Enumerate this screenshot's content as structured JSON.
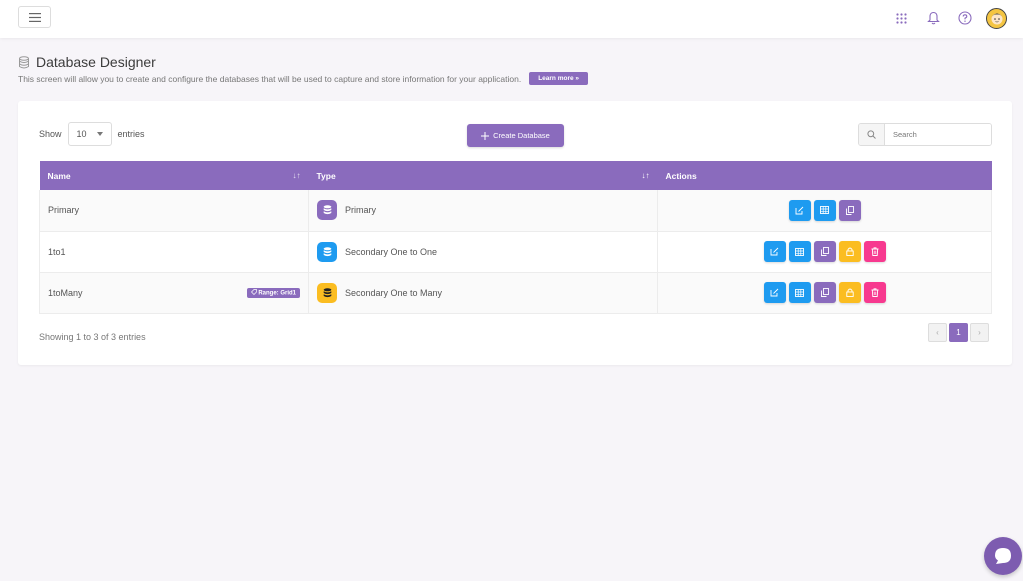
{
  "page": {
    "title": "Database Designer",
    "description": "This screen will allow you to create and configure the databases that will be used to capture and store information for your application.",
    "learn_more": "Learn more »"
  },
  "colors": {
    "accent": "#8a6bbd",
    "blue": "#1e9bf0",
    "yellow": "#fbbd21",
    "pink": "#f7398f"
  },
  "controls": {
    "show_label": "Show",
    "entries_label": "entries",
    "page_length": "10",
    "create_label": "Create Database",
    "search_placeholder": "Search"
  },
  "table": {
    "headers": [
      "Name",
      "Type",
      "Actions"
    ],
    "rows": [
      {
        "name": "Primary",
        "type": "Primary",
        "type_color": "#8a6bbd",
        "badge": "",
        "actions": [
          "edit-icon",
          "grid-icon",
          "copy-icon"
        ]
      },
      {
        "name": "1to1",
        "type": "Secondary One to One",
        "type_color": "#1e9bf0",
        "badge": "",
        "actions": [
          "edit-icon",
          "grid-icon",
          "copy-icon",
          "lock-icon",
          "trash-icon"
        ]
      },
      {
        "name": "1toMany",
        "type": "Secondary One to Many",
        "type_color": "#fbbd21",
        "badge": "Range: Grid1",
        "actions": [
          "edit-icon",
          "grid-icon",
          "copy-icon",
          "lock-icon",
          "trash-icon"
        ]
      }
    ]
  },
  "footer": {
    "info": "Showing 1 to 3 of 3 entries",
    "prev": "‹",
    "page": "1",
    "next": "›"
  },
  "icons": [
    "hamburger-icon",
    "apps-grid-icon",
    "bell-icon",
    "help-icon",
    "avatar",
    "database-icon",
    "search-icon",
    "chat-icon"
  ]
}
